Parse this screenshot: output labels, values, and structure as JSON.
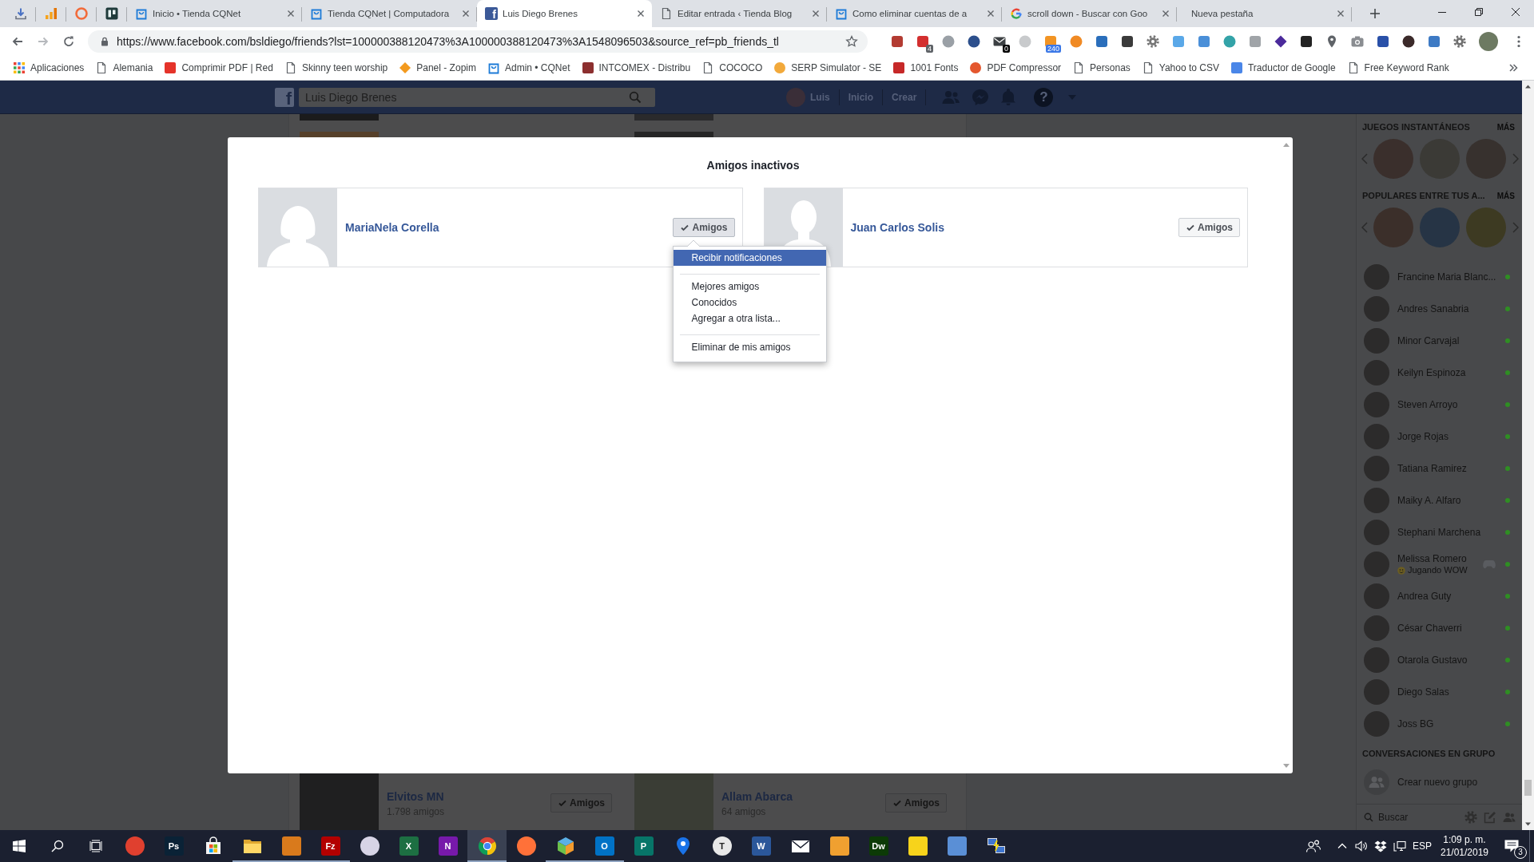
{
  "browser": {
    "pinned_tabs": [
      {
        "kind": "download",
        "selected": false
      },
      {
        "kind": "bars",
        "selected": false
      },
      {
        "kind": "hoop",
        "selected": false
      },
      {
        "kind": "board",
        "selected": false
      }
    ],
    "tabs": [
      {
        "title": "Inicio • Tienda CQNet",
        "kind": "bag",
        "selected": false
      },
      {
        "title": "Tienda CQNet | Computadora",
        "kind": "bag",
        "selected": false
      },
      {
        "title": "Luis Diego Brenes",
        "kind": "logo",
        "logo": "f",
        "selected": true
      },
      {
        "title": "Editar entrada ‹ Tienda Blog",
        "kind": "page",
        "selected": false
      },
      {
        "title": "Como eliminar cuentas de a",
        "kind": "bag",
        "selected": false
      },
      {
        "title": "scroll down - Buscar con Goo",
        "kind": "ring",
        "selected": false
      },
      {
        "title": "Nueva pestaña",
        "kind": "blank",
        "selected": false
      }
    ],
    "url": "https://www.facebook.com/bsldiego/friends?lst=100000388120473%3A100000388120473%3A1548096503&source_ref=pb_friends_tl",
    "extensions": [
      {
        "kind": "tile",
        "color": "#b33b32"
      },
      {
        "kind": "tile",
        "color": "#d32f2f",
        "badge": {
          "text": "4",
          "color": "#5f6368"
        }
      },
      {
        "kind": "circle",
        "color": "#9aa0a6"
      },
      {
        "kind": "circle",
        "color": "#2c4f8c"
      },
      {
        "kind": "envelope",
        "color": "#3c4043",
        "badge": {
          "text": "0",
          "color": "#000000"
        }
      },
      {
        "kind": "circle",
        "color": "#c8cacc"
      },
      {
        "kind": "tile",
        "color": "#f29423",
        "badge": {
          "text": "240",
          "color": "#3b78e7"
        }
      },
      {
        "kind": "circle",
        "color": "#f08a24"
      },
      {
        "kind": "tile",
        "color": "#2a6ebb"
      },
      {
        "kind": "tile",
        "color": "#3a3a3a"
      },
      {
        "kind": "gear",
        "color": "#757575"
      },
      {
        "kind": "tile",
        "color": "#5aa8e8"
      },
      {
        "kind": "tile",
        "color": "#4a8fd8"
      },
      {
        "kind": "circle",
        "color": "#33a3a8"
      },
      {
        "kind": "tile",
        "color": "#a0a4a8"
      },
      {
        "kind": "diamond",
        "color": "#4b2a9b"
      },
      {
        "kind": "tile",
        "color": "#222222"
      },
      {
        "kind": "pin",
        "color": "#5f6368"
      },
      {
        "kind": "camera",
        "color": "#8a8d91"
      },
      {
        "kind": "tile",
        "color": "#2950a8"
      },
      {
        "kind": "circle",
        "color": "#3b2a2a"
      },
      {
        "kind": "tile",
        "color": "#3d7ac4"
      },
      {
        "kind": "gear",
        "color": "#6f6f6f"
      }
    ],
    "bookmarks": [
      {
        "label": "Aplicaciones",
        "kind": "apps"
      },
      {
        "label": "Alemania",
        "kind": "page"
      },
      {
        "label": "Comprimir PDF | Red",
        "kind": "tile",
        "color": "#e5332a"
      },
      {
        "label": "Skinny teen worship",
        "kind": "page"
      },
      {
        "label": "Panel - Zopim",
        "kind": "diamond",
        "color": "#f39a1e"
      },
      {
        "label": "Admin • CQNet",
        "kind": "bag"
      },
      {
        "label": "INTCOMEX - Distribu",
        "kind": "tile",
        "color": "#8c2f2f"
      },
      {
        "label": "COCOCO",
        "kind": "page"
      },
      {
        "label": "SERP Simulator - SE",
        "kind": "circle",
        "color": "#f2a93b"
      },
      {
        "label": "1001 Fonts",
        "kind": "tile",
        "color": "#c62828"
      },
      {
        "label": "PDF Compressor",
        "kind": "circle",
        "color": "#e4572e"
      },
      {
        "label": "Personas",
        "kind": "page"
      },
      {
        "label": "Yahoo to CSV",
        "kind": "page"
      },
      {
        "label": "Traductor de Google",
        "kind": "tile",
        "color": "#4a86e8"
      },
      {
        "label": "Free Keyword Rank",
        "kind": "page"
      }
    ]
  },
  "facebook": {
    "header": {
      "logo": "f",
      "search_value": "Luis Diego Brenes",
      "profile_name": "Luis",
      "links": [
        "Inicio",
        "Crear"
      ],
      "help": "?"
    },
    "friends_list": [
      {
        "name": "Elvitos MN",
        "friend_count": "1.798 amigos",
        "button": "Amigos"
      },
      {
        "name": "Allam Abarca",
        "friend_count": "64 amigos",
        "button": "Amigos"
      }
    ],
    "modal": {
      "title": "Amigos inactivos",
      "friends": [
        {
          "name": "MariaNela Corella",
          "kind": "long-hair",
          "button": "Amigos",
          "menu_open": true
        },
        {
          "name": "Juan Carlos Solis",
          "kind": "short-hair",
          "button": "Amigos",
          "menu_open": false
        }
      ],
      "menu": {
        "sections": [
          {
            "items": [
              {
                "label": "Recibir notificaciones",
                "selected": true
              }
            ]
          },
          {
            "items": [
              {
                "label": "Mejores amigos",
                "selected": false
              },
              {
                "label": "Conocidos",
                "selected": false
              },
              {
                "label": "Agregar a otra lista...",
                "selected": false
              }
            ]
          },
          {
            "items": [
              {
                "label": "Eliminar de mis amigos",
                "selected": false
              }
            ]
          }
        ]
      }
    },
    "sidebar": {
      "sections": [
        {
          "title": "JUEGOS INSTANTÁNEOS",
          "more": "MÁS"
        },
        {
          "title": "POPULARES ENTRE TUS A...",
          "more": "MÁS"
        }
      ],
      "contacts": [
        {
          "name": "Francine Maria Blanc...",
          "online": true
        },
        {
          "name": "Andres Sanabria",
          "online": true
        },
        {
          "name": "Minor Carvajal",
          "online": true
        },
        {
          "name": "Keilyn Espinoza",
          "online": true
        },
        {
          "name": "Steven Arroyo",
          "online": true
        },
        {
          "name": "Jorge Rojas",
          "online": true
        },
        {
          "name": "Tatiana Ramirez",
          "online": true
        },
        {
          "name": "Maiky A. Alfaro",
          "online": true
        },
        {
          "name": "Stephani Marchena",
          "online": true
        },
        {
          "name": "Melissa Romero",
          "status": "Jugando WOW",
          "online": true
        },
        {
          "name": "Andrea Guty",
          "online": true
        },
        {
          "name": "César Chaverri",
          "online": true
        },
        {
          "name": "Otarola Gustavo",
          "online": true
        },
        {
          "name": "Diego Salas",
          "online": true
        },
        {
          "name": "Joss BG",
          "online": true
        }
      ],
      "groups_title": "CONVERSACIONES EN GRUPO",
      "create_group": "Crear nuevo grupo",
      "search_placeholder": "Buscar"
    }
  },
  "taskbar": {
    "apps": [
      {
        "kind": "circle",
        "color": "#e0402f",
        "running": false,
        "selected": false
      },
      {
        "kind": "tile",
        "color": "#0a2236",
        "label": "Ps",
        "running": false,
        "selected": false
      },
      {
        "kind": "bag",
        "running": false,
        "selected": false
      },
      {
        "kind": "folder",
        "running": true,
        "selected": false
      },
      {
        "kind": "tile",
        "color": "#d97a1c",
        "running": true,
        "selected": false
      },
      {
        "kind": "tile",
        "color": "#b30000",
        "label": "Fz",
        "running": true,
        "selected": false
      },
      {
        "kind": "circle",
        "color": "#d7d4e6",
        "running": false,
        "selected": false
      },
      {
        "kind": "tile",
        "color": "#1d6f42",
        "label": "X",
        "running": false,
        "selected": false
      },
      {
        "kind": "tile",
        "color": "#7719aa",
        "label": "N",
        "running": false,
        "selected": false
      },
      {
        "kind": "wheel",
        "running": true,
        "selected": true
      },
      {
        "kind": "circle",
        "color": "#ff7139",
        "running": false,
        "selected": false
      },
      {
        "kind": "cube",
        "running": true,
        "selected": false
      },
      {
        "kind": "tile",
        "color": "#0072c6",
        "label": "O",
        "running": true,
        "selected": false
      },
      {
        "kind": "tile",
        "color": "#077568",
        "label": "P",
        "running": false,
        "selected": false
      },
      {
        "kind": "pin",
        "color": "#1a73e8",
        "running": false,
        "selected": false
      },
      {
        "kind": "circle",
        "color": "#e8e8e8",
        "label": "T",
        "running": false,
        "selected": false
      },
      {
        "kind": "tile",
        "color": "#2b579a",
        "label": "W",
        "running": false,
        "selected": false
      },
      {
        "kind": "envelope",
        "running": false,
        "selected": false
      },
      {
        "kind": "tile",
        "color": "#f0a030",
        "running": false,
        "selected": false
      },
      {
        "kind": "tile",
        "color": "#0c3a06",
        "label": "Dw",
        "running": false,
        "selected": false
      },
      {
        "kind": "tile",
        "color": "#f7d31b",
        "running": false,
        "selected": false
      },
      {
        "kind": "tile",
        "color": "#5a8fd6",
        "running": false,
        "selected": false
      },
      {
        "kind": "network",
        "running": false,
        "selected": false
      }
    ],
    "language": "ESP",
    "time": "1:09 p. m.",
    "date": "21/01/2019",
    "notification_count": "3"
  }
}
